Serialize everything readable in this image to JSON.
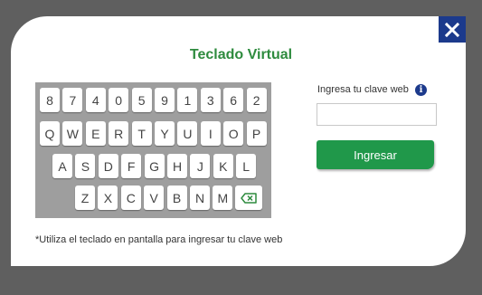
{
  "dialog": {
    "title": "Teclado Virtual",
    "close_icon": "close-icon",
    "colors": {
      "accent_green": "#2e8b3e",
      "close_bg": "#1c3a8c"
    }
  },
  "keyboard": {
    "row1": [
      "8",
      "7",
      "4",
      "0",
      "5",
      "9",
      "1",
      "3",
      "6",
      "2"
    ],
    "row2": [
      "Q",
      "W",
      "E",
      "R",
      "T",
      "Y",
      "U",
      "I",
      "O",
      "P"
    ],
    "row3": [
      "A",
      "S",
      "D",
      "F",
      "G",
      "H",
      "J",
      "K",
      "L"
    ],
    "row4": [
      "Z",
      "X",
      "C",
      "V",
      "B",
      "N",
      "M"
    ],
    "backspace_icon": "backspace-icon"
  },
  "form": {
    "label": "Ingresa tu clave web",
    "info_icon": "info-icon",
    "password_value": "",
    "submit_label": "Ingresar"
  },
  "footnote": "*Utiliza el teclado en pantalla para ingresar tu clave web"
}
